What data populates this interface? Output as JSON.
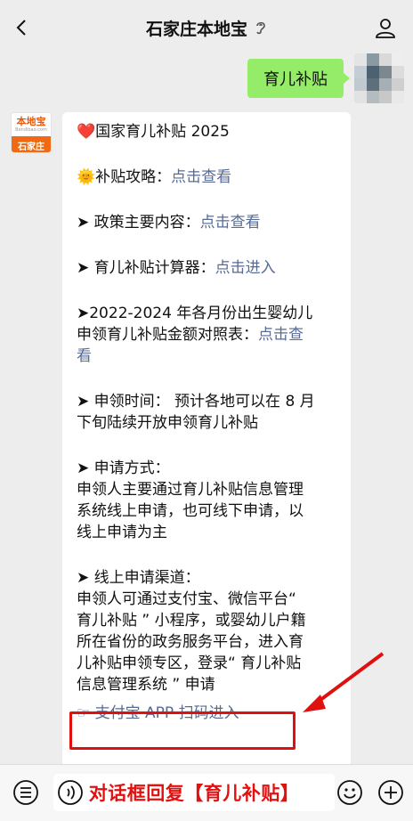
{
  "nav": {
    "title": "石家庄本地宝",
    "back_icon": "chevron-left-icon",
    "ear_icon": "ear-icon",
    "profile_icon": "person-icon"
  },
  "user_message": {
    "text": "育儿补贴"
  },
  "bot_avatar": {
    "logo_text": "本地宝",
    "logo_url": "Bendibao.com",
    "city": "石家庄"
  },
  "article": {
    "title": "❤️国家育儿补贴 2025",
    "strategy_label": "🌞补贴攻略：",
    "strategy_link": "点击查看",
    "policy_label": "➤ 政策主要内容：",
    "policy_link": "点击查看",
    "calc_label": "➤ 育儿补贴计算器：",
    "calc_link": "点击进入",
    "table_line1": "➤2022-2024 年各月份出生婴幼儿",
    "table_line2": "申领育儿补贴金额对照表：",
    "table_link_a": "点击查",
    "table_link_b": "看",
    "time_line1": "➤ 申领时间：  预计各地可以在 8 月",
    "time_line2": "下旬陆续开放申领育儿补贴",
    "method_head": "➤ 申请方式：",
    "method_line1": "申领人主要通过育儿补贴信息管理",
    "method_line2": "系统线上申请，也可线下申请，以",
    "method_line3": "线上申请为主",
    "channel_head": "➤ 线上申请渠道：",
    "channel_line1": "申领人可通过支付宝、微信平台“",
    "channel_line2": "育儿补贴 ” 小程序，或婴幼儿户籍",
    "channel_line3": "所在省份的政务服务平台，进入育",
    "channel_line4": "儿补贴申领专区，登录“ 育儿补贴",
    "channel_line5": "信息管理系统 ” 申请",
    "alipay_link": "☞ 支付宝 APP 扫码进入"
  },
  "bottom_bar": {
    "menu_icon": "list-menu-icon",
    "voice_icon": "voice-icon",
    "input_text": "对话框回复【育儿补贴】",
    "emoji_icon": "emoji-icon",
    "plus_icon": "plus-icon"
  },
  "colors": {
    "background": "#ededed",
    "user_bubble": "#95ec69",
    "link": "#576b95",
    "highlight": "#e01010",
    "brand": "#ef6a12"
  }
}
